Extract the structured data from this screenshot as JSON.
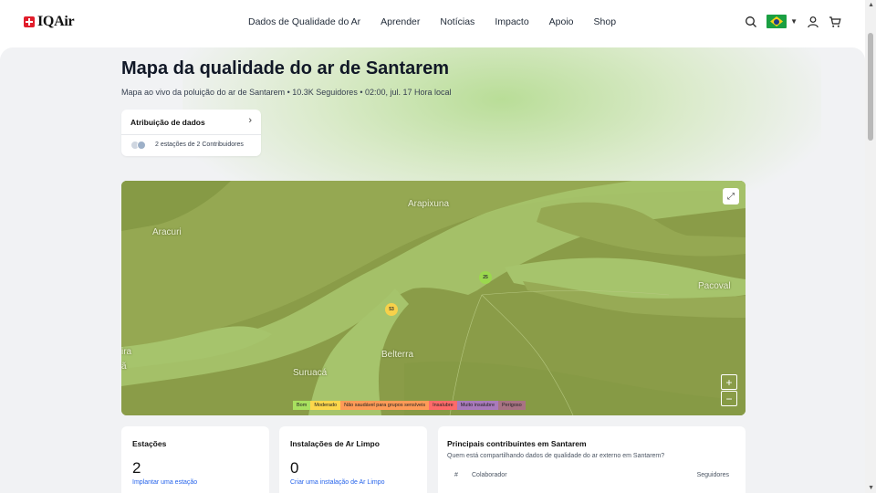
{
  "header": {
    "logo_text": "IQAir",
    "nav": [
      "Dados de Qualidade do Ar",
      "Aprender",
      "Notícias",
      "Impacto",
      "Apoio",
      "Shop"
    ]
  },
  "page": {
    "title": "Mapa da qualidade do ar de Santarem",
    "subtitle": "Mapa ao vivo da poluição do ar de Santarem • 10.3K Seguidores • 02:00, jul. 17 Hora local"
  },
  "attribution": {
    "heading": "Atribuição de dados",
    "text": "2 estações de 2 Contribuidores"
  },
  "map": {
    "labels": {
      "aracuri": "Aracuri",
      "suruaca": "Suruacá",
      "belterra": "Belterra",
      "arapixuna": "Arapixuna",
      "pacoval": "Pacoval",
      "ira": "ira",
      "a": "ã"
    },
    "markers": [
      {
        "value": "25",
        "color": "#9bd84e"
      },
      {
        "value": "53",
        "color": "#f7d14a"
      }
    ],
    "legend": [
      {
        "label": "Bom",
        "color": "#a8e05f"
      },
      {
        "label": "Moderado",
        "color": "#fdd74b"
      },
      {
        "label": "Não saudável para grupos sensíveis",
        "color": "#fe9b57"
      },
      {
        "label": "Insalubre",
        "color": "#fe6a69"
      },
      {
        "label": "Muito insalubre",
        "color": "#a97abc"
      },
      {
        "label": "Perigoso",
        "color": "#a87383"
      }
    ],
    "zoom_in": "+",
    "zoom_out": "−"
  },
  "cards": {
    "stations": {
      "title": "Estações",
      "count": "2",
      "link": "Implantar uma estação"
    },
    "clean_air": {
      "title": "Instalações de Ar Limpo",
      "count": "0",
      "link": "Criar uma instalação de Ar Limpo"
    },
    "contributors": {
      "title": "Principais contribuintes em Santarem",
      "subtitle": "Quem está compartilhando dados de qualidade do ar externo em Santarem?",
      "col_rank": "#",
      "col_name": "Colaborador",
      "col_followers": "Seguidores"
    }
  }
}
